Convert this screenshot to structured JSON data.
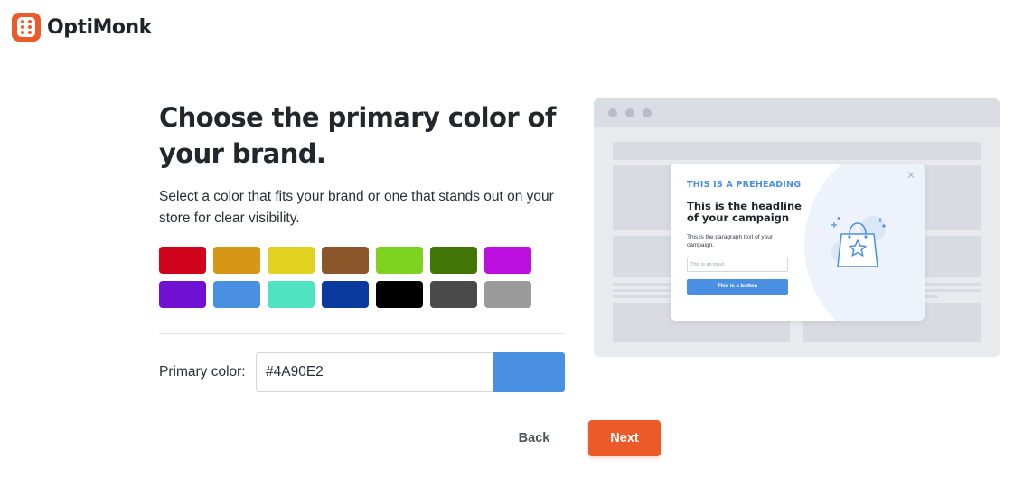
{
  "brand": {
    "name": "OptiMonk",
    "logo_icon": "optimonk-logo-icon",
    "logo_color": "#ED5A29"
  },
  "page": {
    "title": "Choose the primary color of your brand.",
    "description": "Select a color that fits your brand or one that stands out on your store for clear visibility."
  },
  "swatches": [
    "#D0021B",
    "#D89616",
    "#E0D21F",
    "#8B572A",
    "#7ED321",
    "#417505",
    "#BD10E0",
    "#7010D3",
    "#4A90E2",
    "#50E3C2",
    "#0B3A9E",
    "#000000",
    "#4A4A4A",
    "#9B9B9B"
  ],
  "primary_color": {
    "label": "Primary color:",
    "value": "#4A90E2"
  },
  "buttons": {
    "back": "Back",
    "next": "Next",
    "next_color": "#ED5A29"
  },
  "preview": {
    "preheading": "THIS IS A PREHEADING",
    "headline": "This is the headline of your campaign",
    "paragraph": "This is the paragraph text of your campaign.",
    "input_placeholder": "This is an input",
    "button_label": "This is a button",
    "close_icon": "close-icon",
    "illustration_icon": "shopping-bag-star-icon"
  }
}
